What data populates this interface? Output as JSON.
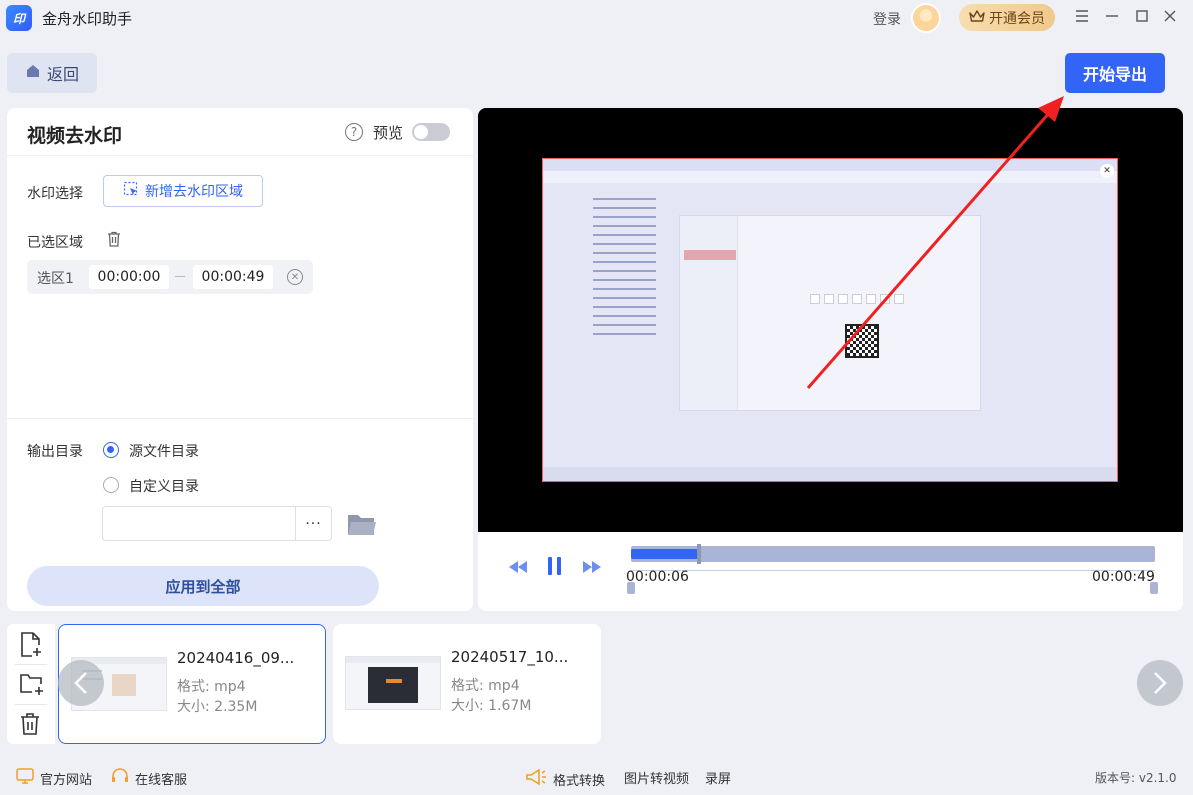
{
  "app": {
    "logo_text": "印",
    "title": "金舟水印助手"
  },
  "header": {
    "login_label": "登录",
    "vip_label": "开通会员"
  },
  "toolbar": {
    "back_label": "返回",
    "export_label": "开始导出"
  },
  "panel": {
    "title": "视频去水印",
    "preview_label": "预览",
    "watermark_select_label": "水印选择",
    "add_region_label": "新增去水印区域",
    "selected_regions_label": "已选区域",
    "regions": [
      {
        "name": "选区1",
        "start": "00:00:00",
        "end": "00:00:49"
      }
    ],
    "output_dir_label": "输出目录",
    "source_dir_label": "源文件目录",
    "custom_dir_label": "自定义目录",
    "dir_value": "",
    "more_label": "···",
    "apply_all_label": "应用到全部"
  },
  "player": {
    "current_time": "00:00:06",
    "total_time": "00:00:49",
    "progress": 0.13
  },
  "files": [
    {
      "name": "20240416_09...",
      "format": "格式: mp4",
      "size": "大小: 2.35M"
    },
    {
      "name": "20240517_10...",
      "format": "格式: mp4",
      "size": "大小: 1.67M"
    }
  ],
  "footer": {
    "official_site": "官方网站",
    "online_service": "在线客服",
    "format_convert": "格式转换",
    "image_to_video": "图片转视频",
    "screen_record": "录屏",
    "version": "版本号: v2.1.0"
  },
  "colors": {
    "accent": "#3264f5",
    "annotation": "#f02020"
  }
}
